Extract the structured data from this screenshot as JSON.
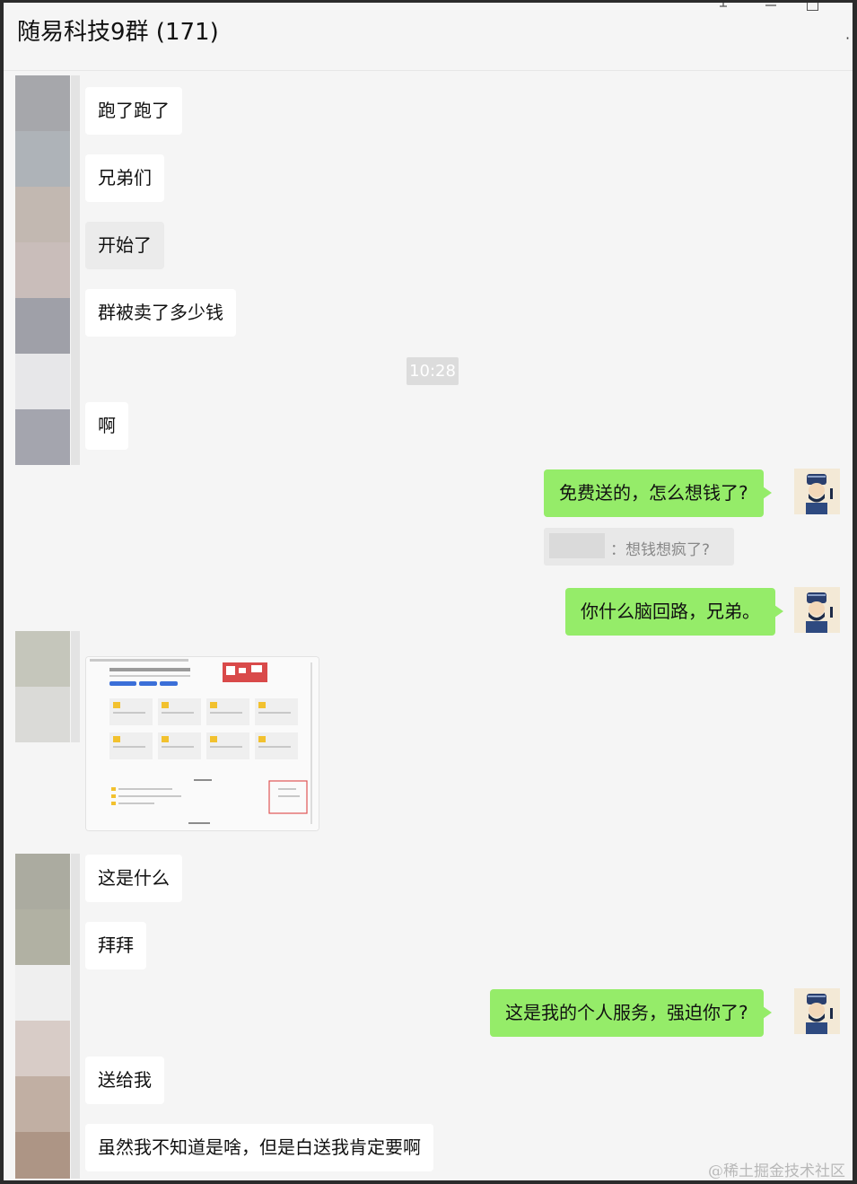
{
  "header": {
    "title": "随易科技9群 (171)",
    "menu_glyph": "·",
    "icons": [
      "pin-icon",
      "minimize-icon",
      "maximize-icon",
      "more-icon"
    ]
  },
  "messages": {
    "m1": "跑了跑了",
    "m2": "兄弟们",
    "m3": "开始了",
    "m4": "群被卖了多少钱",
    "time": "10:28",
    "m5": "啊",
    "r1": "免费送的，怎么想钱了?",
    "quote": "：想钱想疯了?",
    "r2": "你什么脑回路，兄弟。",
    "m6": "这是什么",
    "m7": "拜拜",
    "r3": "这是我的个人服务，强迫你了?",
    "m8": "送给我",
    "m9": "虽然我不知道是啥，但是白送我肯定要啊"
  },
  "watermark": "@稀土掘金技术社区",
  "colors": {
    "self_bubble": "#95ec69",
    "other_bubble": "#ffffff",
    "background": "#f5f5f5"
  }
}
